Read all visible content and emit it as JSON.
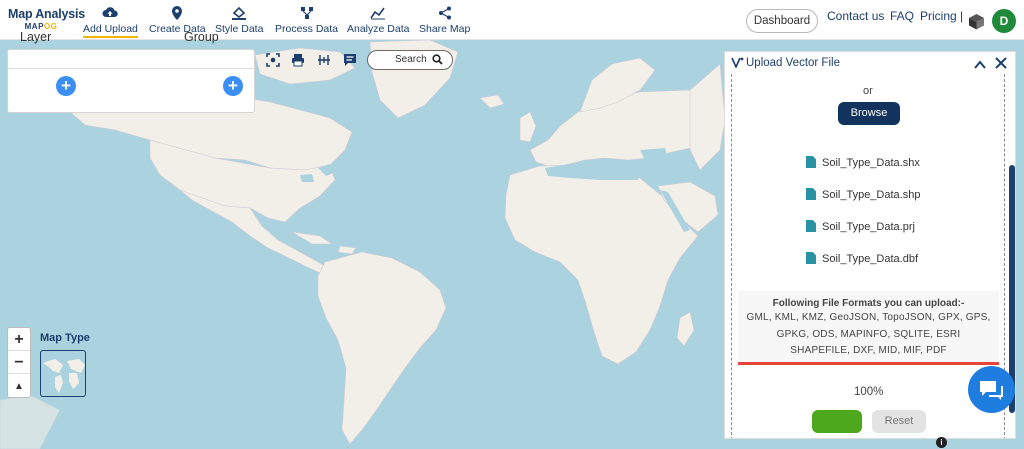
{
  "brand": {
    "title": "Map Analysis",
    "sub_prefix": "MAP",
    "sub_accent": "OG"
  },
  "nav": [
    {
      "label": "Add Upload",
      "icon": "cloud-upload-icon"
    },
    {
      "label": "Create Data",
      "icon": "map-pin-icon"
    },
    {
      "label": "Style Data",
      "icon": "paint-bucket-icon"
    },
    {
      "label": "Process Data",
      "icon": "process-nodes-icon"
    },
    {
      "label": "Analyze Data",
      "icon": "analyze-chart-icon"
    },
    {
      "label": "Share Map",
      "icon": "share-icon"
    }
  ],
  "header_right": {
    "dashboard": "Dashboard",
    "contact": "Contact us",
    "faq": "FAQ",
    "pricing": "Pricing |",
    "avatar_letter": "D"
  },
  "layer_panel": {
    "layer_label": "Layer",
    "group_label": "Group",
    "add_symbol": "+"
  },
  "map_toolbar": {
    "search_label": "Search",
    "icons": [
      "focus-icon",
      "print-icon",
      "measure-icon",
      "comment-icon"
    ]
  },
  "map_controls": {
    "zoom_in": "+",
    "zoom_out": "−",
    "north": "▲",
    "map_type_label": "Map Type"
  },
  "upload_panel": {
    "title": "Upload Vector File",
    "or_text": "or",
    "browse_label": "Browse",
    "files": [
      "Soil_Type_Data.shx",
      "Soil_Type_Data.shp",
      "Soil_Type_Data.prj",
      "Soil_Type_Data.dbf"
    ],
    "formats_title": "Following File Formats you can upload:-",
    "formats_list": "GML, KML, KMZ, GeoJSON, TopoJSON, GPX, GPS, GPKG, ODS, MAPINFO, SQLITE, ESRI SHAPEFILE, DXF, MID, MIF, PDF",
    "progress_text": "100%",
    "progress": 1.0,
    "reset_label": "Reset"
  },
  "colors": {
    "brand_navy": "#1c3f6e",
    "accent_yellow": "#f2b705",
    "ocean": "#aad3df",
    "land": "#f2efe9",
    "browse_bg": "#12335e",
    "upload_green": "#4ea81e",
    "progress_red": "#e8443a",
    "chat_blue": "#1f7de0",
    "avatar_green": "#1f8a3a"
  }
}
